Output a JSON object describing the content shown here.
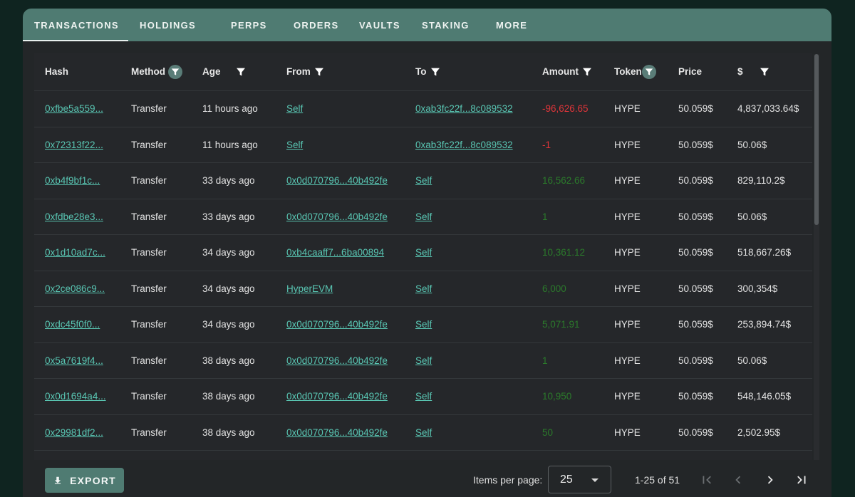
{
  "tabs": [
    {
      "label": "TRANSACTIONS",
      "active": true
    },
    {
      "label": "HOLDINGS"
    },
    {
      "label": "PERPS"
    },
    {
      "label": "ORDERS"
    },
    {
      "label": "VAULTS"
    },
    {
      "label": "STAKING"
    },
    {
      "label": "MORE"
    }
  ],
  "table": {
    "columns": {
      "hash": "Hash",
      "method": "Method",
      "age": "Age",
      "from": "From",
      "to": "To",
      "amount": "Amount",
      "token": "Token",
      "price": "Price",
      "usd": "$"
    },
    "rows": [
      {
        "hash": "0xfbe5a559...",
        "method": "Transfer",
        "age": "11 hours ago",
        "from": "Self",
        "to": "0xab3fc22f...8c089532",
        "amount": "-96,626.65",
        "sign": "neg",
        "token": "HYPE",
        "price": "50.059$",
        "usd": "4,837,033.64$"
      },
      {
        "hash": "0x72313f22...",
        "method": "Transfer",
        "age": "11 hours ago",
        "from": "Self",
        "to": "0xab3fc22f...8c089532",
        "amount": "-1",
        "sign": "neg",
        "token": "HYPE",
        "price": "50.059$",
        "usd": "50.06$"
      },
      {
        "hash": "0xb4f9bf1c...",
        "method": "Transfer",
        "age": "33 days ago",
        "from": "0x0d070796...40b492fe",
        "to": "Self",
        "amount": "16,562.66",
        "sign": "pos",
        "token": "HYPE",
        "price": "50.059$",
        "usd": "829,110.2$"
      },
      {
        "hash": "0xfdbe28e3...",
        "method": "Transfer",
        "age": "33 days ago",
        "from": "0x0d070796...40b492fe",
        "to": "Self",
        "amount": "1",
        "sign": "pos",
        "token": "HYPE",
        "price": "50.059$",
        "usd": "50.06$"
      },
      {
        "hash": "0x1d10ad7c...",
        "method": "Transfer",
        "age": "34 days ago",
        "from": "0xb4caaff7...6ba00894",
        "to": "Self",
        "amount": "10,361.12",
        "sign": "pos",
        "token": "HYPE",
        "price": "50.059$",
        "usd": "518,667.26$"
      },
      {
        "hash": "0x2ce086c9...",
        "method": "Transfer",
        "age": "34 days ago",
        "from": "HyperEVM",
        "to": "Self",
        "amount": "6,000",
        "sign": "pos",
        "token": "HYPE",
        "price": "50.059$",
        "usd": "300,354$"
      },
      {
        "hash": "0xdc45f0f0...",
        "method": "Transfer",
        "age": "34 days ago",
        "from": "0x0d070796...40b492fe",
        "to": "Self",
        "amount": "5,071.91",
        "sign": "pos",
        "token": "HYPE",
        "price": "50.059$",
        "usd": "253,894.74$"
      },
      {
        "hash": "0x5a7619f4...",
        "method": "Transfer",
        "age": "38 days ago",
        "from": "0x0d070796...40b492fe",
        "to": "Self",
        "amount": "1",
        "sign": "pos",
        "token": "HYPE",
        "price": "50.059$",
        "usd": "50.06$"
      },
      {
        "hash": "0x0d1694a4...",
        "method": "Transfer",
        "age": "38 days ago",
        "from": "0x0d070796...40b492fe",
        "to": "Self",
        "amount": "10,950",
        "sign": "pos",
        "token": "HYPE",
        "price": "50.059$",
        "usd": "548,146.05$"
      },
      {
        "hash": "0x29981df2...",
        "method": "Transfer",
        "age": "38 days ago",
        "from": "0x0d070796...40b492fe",
        "to": "Self",
        "amount": "50",
        "sign": "pos",
        "token": "HYPE",
        "price": "50.059$",
        "usd": "2,502.95$"
      }
    ]
  },
  "footer": {
    "export_label": "EXPORT",
    "items_per_page_label": "Items per page:",
    "items_per_page_value": "25",
    "range_label": "1-25 of 51"
  },
  "colors": {
    "accent": "#4f7b72",
    "link": "#59c6b3",
    "negative": "#e0353a",
    "positive": "#2b7a2b"
  },
  "icons": {
    "filter": "filter-icon",
    "export": "download-icon",
    "first": "first-page-icon",
    "prev": "chevron-left-icon",
    "next": "chevron-right-icon",
    "last": "last-page-icon"
  }
}
